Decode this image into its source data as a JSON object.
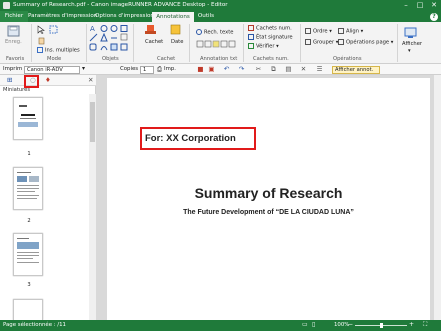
{
  "window": {
    "title": "Summary of Research.pdf - Canon imageRUNNER ADVANCE Desktop - Editor",
    "min": "–",
    "max": "□",
    "close": "✕"
  },
  "tabs": [
    {
      "label": "Fichier"
    },
    {
      "label": "Paramètres d'impression"
    },
    {
      "label": "Options d'impression"
    },
    {
      "label": "Annotations"
    },
    {
      "label": "Outils"
    }
  ],
  "help": "?",
  "ribbon": {
    "favoris": {
      "enreg": "Enreg.",
      "label": "Favoris"
    },
    "mode": {
      "ins_multiples": "Ins. multiples",
      "label": "Mode"
    },
    "objets": {
      "label": "Objets"
    },
    "cachet": {
      "cachet": "Cachet",
      "date": "Date",
      "label": "Cachet"
    },
    "annotation_txt": {
      "rech_texte": "Rech. texte",
      "label": "Annotation txt"
    },
    "cachets_num": {
      "cachets": "Cachets num.",
      "etat": "État signature",
      "verifier": "Vérifier",
      "label": "Cachets num."
    },
    "operations": {
      "ordre": "Ordre",
      "aligner": "Align",
      "grouper": "Grouper",
      "ops_page": "Opérations page",
      "label": "Opérations"
    },
    "afficher": {
      "label": "Afficher"
    }
  },
  "toolbar": {
    "imprimer_label": "Imprim",
    "printer": "Canon iR-ADV",
    "copies_label": "Copies",
    "copies_value": "1",
    "imp_label": "Imp.",
    "afficher_annot": "Afficher annot."
  },
  "left_pane": {
    "header": "Miniatures",
    "thumb_numbers": [
      "1",
      "2",
      "3"
    ]
  },
  "document": {
    "for_text": "For: XX Corporation",
    "title": "Summary of Research",
    "subtitle": "The Future Development of “DE LA CIUDAD LUNA”"
  },
  "status": {
    "page_selected": "Page sélectionnée : /11",
    "zoom": "100%"
  },
  "colors": {
    "brand_green": "#1f7a3a",
    "highlight_red": "#e11a1a"
  }
}
